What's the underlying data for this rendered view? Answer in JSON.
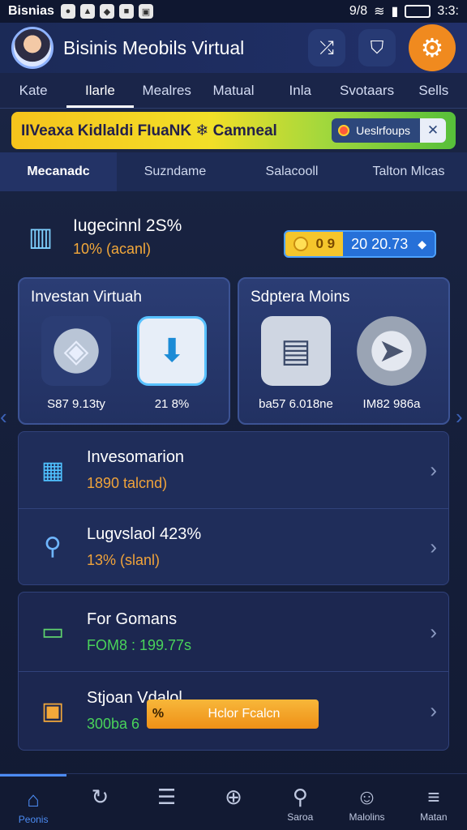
{
  "status_bar": {
    "app_name": "Bisnias",
    "time": "3:3:",
    "left_code": "9/8"
  },
  "header": {
    "title": "Bisinis Meobils Virtual",
    "actions": [
      {
        "icon": "shuffle-icon",
        "glyph": "⤮"
      },
      {
        "icon": "shield-check-icon",
        "glyph": "⛉"
      },
      {
        "icon": "gear-icon",
        "glyph": "⚙"
      }
    ]
  },
  "tabs": [
    {
      "label": "Kate"
    },
    {
      "label": "Ilarle",
      "active": true
    },
    {
      "label": "Mealres"
    },
    {
      "label": "Matual"
    },
    {
      "label": "Inla"
    },
    {
      "label": "Svotaars"
    },
    {
      "label": "Sells"
    }
  ],
  "banner": {
    "text": "IIVeaxa Kidlaldi FIuaNK ❄ Camneal",
    "pill_label": "Ueslrfoups",
    "close_glyph": "✕"
  },
  "subtabs": [
    {
      "label": "Mecanadc",
      "active": true
    },
    {
      "label": "Suzndame"
    },
    {
      "label": "Salacooll"
    },
    {
      "label": "Talton Mlcas"
    }
  ],
  "summary": {
    "icon": "wallet-phone-icon",
    "title": "Iugecinnl 2S%",
    "subtitle": "10%  (acanl)",
    "price_left": "0 9",
    "price_right": "20 20.73",
    "price_symbol": "◆"
  },
  "cards": [
    {
      "title": "Investan Virtuah",
      "items": [
        {
          "icon": "shield-icon",
          "glyph": "◈",
          "value": "S87 9.13ty"
        },
        {
          "icon": "download-box-icon",
          "glyph": "⬇",
          "value": "21 8%"
        }
      ]
    },
    {
      "title": "Sdptera Moins",
      "items": [
        {
          "icon": "server-icon",
          "glyph": "▤",
          "value": "ba57 6.018ne"
        },
        {
          "icon": "compass-disc-icon",
          "glyph": "➤",
          "value": "IM82 986a"
        }
      ]
    }
  ],
  "list_group_1": [
    {
      "icon": "tablet-coins-icon",
      "glyph": "▦",
      "title": "Invesomarion",
      "subtitle": "1890 talcnd)"
    },
    {
      "icon": "satellite-icon",
      "glyph": "⚲",
      "title": "Lugvslaol 423%",
      "subtitle": "13%  (slanl)"
    }
  ],
  "list_group_2": [
    {
      "icon": "cash-icon",
      "glyph": "▭",
      "title": "For Gomans",
      "subtitle": "FOM8 : 199.77s"
    },
    {
      "icon": "store-gift-icon",
      "glyph": "▣",
      "title": "Stjoan Vdalol",
      "subtitle": "300ba  6"
    }
  ],
  "cta": {
    "pct": "%",
    "label": "Hclor Fcalcn"
  },
  "bottom_nav": [
    {
      "icon": "home-icon",
      "glyph": "⌂",
      "label": "Peonis",
      "active": true
    },
    {
      "icon": "refresh-icon",
      "glyph": "↻",
      "label": ""
    },
    {
      "icon": "document-icon",
      "glyph": "☰",
      "label": ""
    },
    {
      "icon": "plus-circle-icon",
      "glyph": "⊕",
      "label": ""
    },
    {
      "icon": "search-icon",
      "glyph": "⚲",
      "label": "Saroa"
    },
    {
      "icon": "profile-icon",
      "glyph": "☺",
      "label": "Malolins"
    },
    {
      "icon": "menu-icon",
      "glyph": "≡",
      "label": "Matan"
    }
  ]
}
